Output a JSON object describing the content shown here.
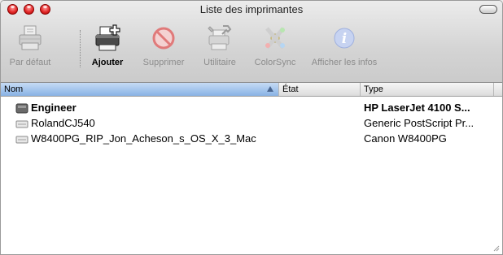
{
  "window": {
    "title": "Liste des imprimantes"
  },
  "toolbar": {
    "default_label": "Par défaut",
    "add_label": "Ajouter",
    "delete_label": "Supprimer",
    "utility_label": "Utilitaire",
    "colorsync_label": "ColorSync",
    "info_label": "Afficher les infos"
  },
  "columns": {
    "name": "Nom",
    "status": "État",
    "type": "Type"
  },
  "printers": [
    {
      "name": "Engineer",
      "status": "",
      "type": "HP LaserJet 4100 S...",
      "bold": true,
      "icon": "printer-queue-icon"
    },
    {
      "name": "RolandCJ540",
      "status": "",
      "type": "Generic PostScript Pr...",
      "bold": false,
      "icon": "printer-queue-icon"
    },
    {
      "name": "W8400PG_RIP_Jon_Acheson_s_OS_X_3_Mac",
      "status": "",
      "type": "Canon W8400PG",
      "bold": false,
      "icon": "printer-queue-icon"
    }
  ],
  "colors": {
    "sorted_header": "#88b2e5",
    "close": "#e42b2b"
  }
}
